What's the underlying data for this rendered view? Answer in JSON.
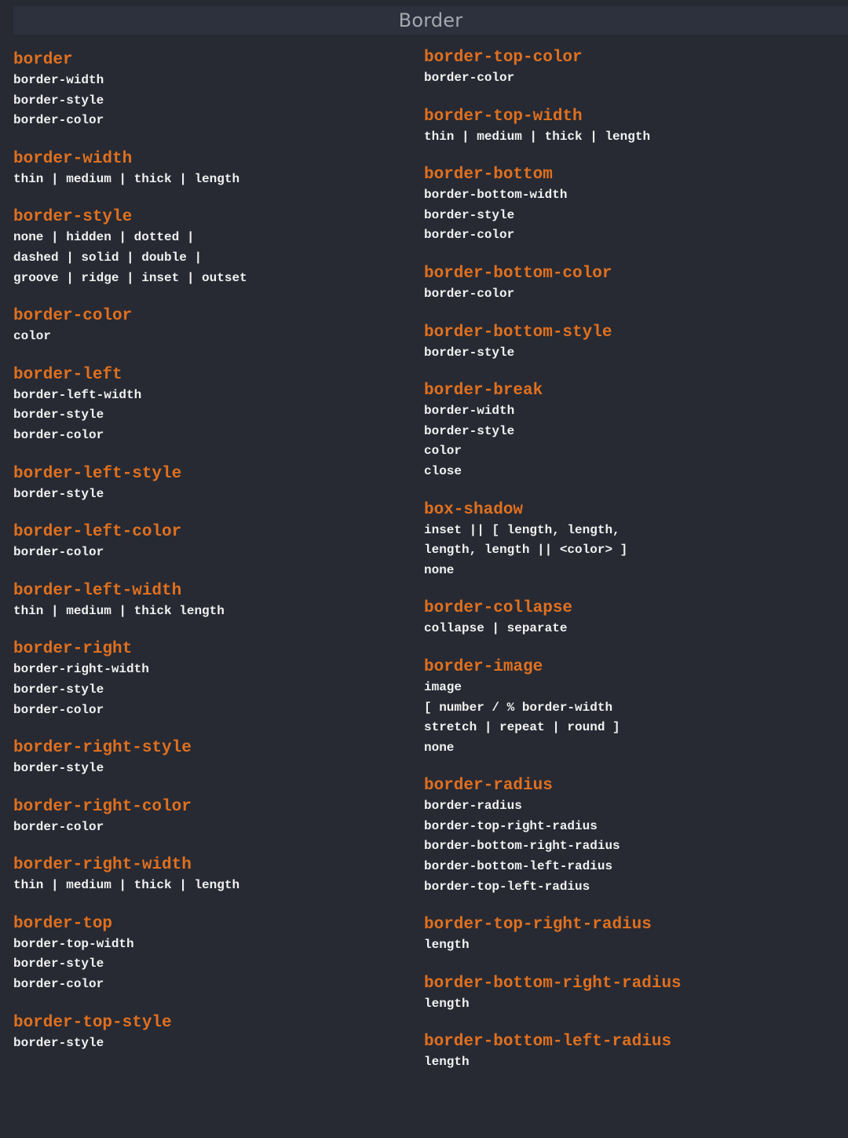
{
  "title": "Border",
  "left_column": [
    {
      "name": "border",
      "lines": [
        "border-width",
        "border-style",
        "border-color"
      ]
    },
    {
      "name": "border-width",
      "lines": [
        "thin | medium | thick | length"
      ]
    },
    {
      "name": "border-style",
      "lines": [
        "none | hidden | dotted |",
        "dashed | solid | double |",
        "groove | ridge | inset | outset"
      ]
    },
    {
      "name": "border-color",
      "lines": [
        "color"
      ]
    },
    {
      "name": "border-left",
      "lines": [
        "border-left-width",
        "border-style",
        "border-color"
      ]
    },
    {
      "name": "border-left-style",
      "lines": [
        "border-style"
      ]
    },
    {
      "name": "border-left-color",
      "lines": [
        "border-color"
      ]
    },
    {
      "name": "border-left-width",
      "lines": [
        "thin | medium | thick length"
      ]
    },
    {
      "name": "border-right",
      "lines": [
        "border-right-width",
        "border-style",
        "border-color"
      ]
    },
    {
      "name": "border-right-style",
      "lines": [
        "border-style"
      ]
    },
    {
      "name": "border-right-color",
      "lines": [
        "border-color"
      ]
    },
    {
      "name": "border-right-width",
      "lines": [
        "thin | medium | thick | length"
      ]
    },
    {
      "name": "border-top",
      "lines": [
        "border-top-width",
        "border-style",
        "border-color"
      ]
    },
    {
      "name": "border-top-style",
      "lines": [
        "border-style"
      ]
    }
  ],
  "right_column": [
    {
      "name": "border-top-color",
      "lines": [
        "border-color"
      ]
    },
    {
      "name": "border-top-width",
      "lines": [
        "thin | medium | thick | length"
      ]
    },
    {
      "name": "border-bottom",
      "lines": [
        "border-bottom-width",
        "border-style",
        "border-color"
      ]
    },
    {
      "name": "border-bottom-color",
      "lines": [
        "border-color"
      ]
    },
    {
      "name": "border-bottom-style",
      "lines": [
        "border-style"
      ]
    },
    {
      "name": "border-break",
      "lines": [
        "border-width",
        "border-style",
        "color",
        "close"
      ]
    },
    {
      "name": "box-shadow",
      "lines": [
        "inset || [ length, length,",
        "length, length || <color> ]",
        "none"
      ]
    },
    {
      "name": "border-collapse",
      "lines": [
        "collapse | separate"
      ]
    },
    {
      "name": "border-image",
      "lines": [
        "image",
        "[ number / % border-width",
        "stretch | repeat | round ]",
        "none"
      ]
    },
    {
      "name": "border-radius",
      "lines": [
        "border-radius",
        "border-top-right-radius",
        "border-bottom-right-radius",
        "border-bottom-left-radius",
        "border-top-left-radius"
      ]
    },
    {
      "name": "border-top-right-radius",
      "lines": [
        "length"
      ]
    },
    {
      "name": "border-bottom-right-radius",
      "lines": [
        "length"
      ]
    },
    {
      "name": "border-bottom-left-radius",
      "lines": [
        "length"
      ]
    }
  ],
  "colors": {
    "background": "#272a33",
    "header": "#2d313d",
    "property_name": "#e0701f",
    "value_text": "#f1f1f1",
    "title_text": "#a5a8b0"
  }
}
